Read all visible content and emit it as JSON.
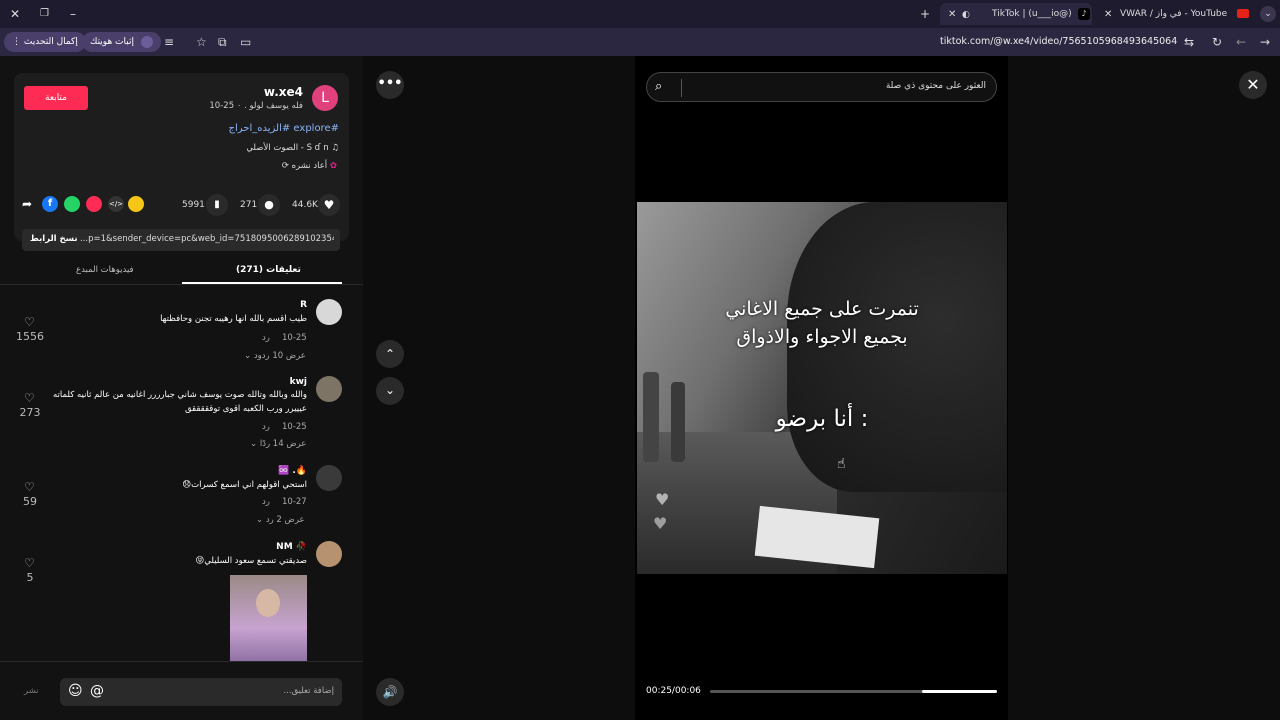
{
  "browser": {
    "tabs": [
      {
        "label": "TikTok | (u___io@)"
      },
      {
        "label": "VWAR / في واز - YouTube"
      }
    ],
    "url": "tiktok.com/@w.xe4/video/7565105968493645064",
    "verify_label": "إثبات هويتك",
    "update_label": "إكمال التحديث"
  },
  "post": {
    "username": "w.xe4",
    "avatar_letter": "L",
    "subtitle": "فله يوسف لولو . ٠ 25-10",
    "follow_label": "متابعة",
    "hashtags": "#explore #الزيده_احراج",
    "sound": "الصوت الأصلي - S ɗ n",
    "repost_label": "أعاد نشره",
    "likes": "44.6K",
    "comments": "271",
    "saves": "5991",
    "link": "...p=1&sender_device=pc&web_id=7518095006289102354",
    "copy_link_label": "نسخ الرابط"
  },
  "tabs": {
    "comments": "تعليقات (271)",
    "creator_videos": "فيديوهات المبدع"
  },
  "comments": [
    {
      "name": "R",
      "text": "طيب اقسم بالله انها رهيبه تجنن وحافظتها",
      "date": "10-25",
      "reply": "رد",
      "likes": "1556",
      "more": "عرض 10 ردود"
    },
    {
      "name": "kwj",
      "text": "والله وبالله وتالله صوت يوسف شاني جبارررر اغانيه من عالم ثانيه كلماته",
      "text2": "عيييرر ورب الكعبه اقوى توقققققق",
      "date": "10-25",
      "reply": "رد",
      "likes": "273",
      "more": "عرض 14 ردًا"
    },
    {
      "name": "♾️ .🔥",
      "text": "استحي اقولهم اني اسمع كسرات😞",
      "date": "10-27",
      "reply": "رد",
      "likes": "59",
      "more": "عرض 2 رد"
    },
    {
      "name": "NM 🥀",
      "text": "صديقتي تسمع سعود السليلي😝",
      "likes": "5"
    }
  ],
  "composer": {
    "placeholder": "إضافة تعليق...",
    "post_label": "نشر"
  },
  "video": {
    "search_placeholder": "العثور على محتوى ذي صلة",
    "overlay_line1": "تنمرت على جميع الاغاني",
    "overlay_line2": "بجميع الاجواء والاذواق",
    "overlay_line3": "أنا برضو :",
    "time": "00:25/00:06",
    "progress": 0.26
  },
  "colors": {
    "accent": "#fe2c55",
    "browser_bg": "#2b2740",
    "panel_bg": "#121212"
  }
}
